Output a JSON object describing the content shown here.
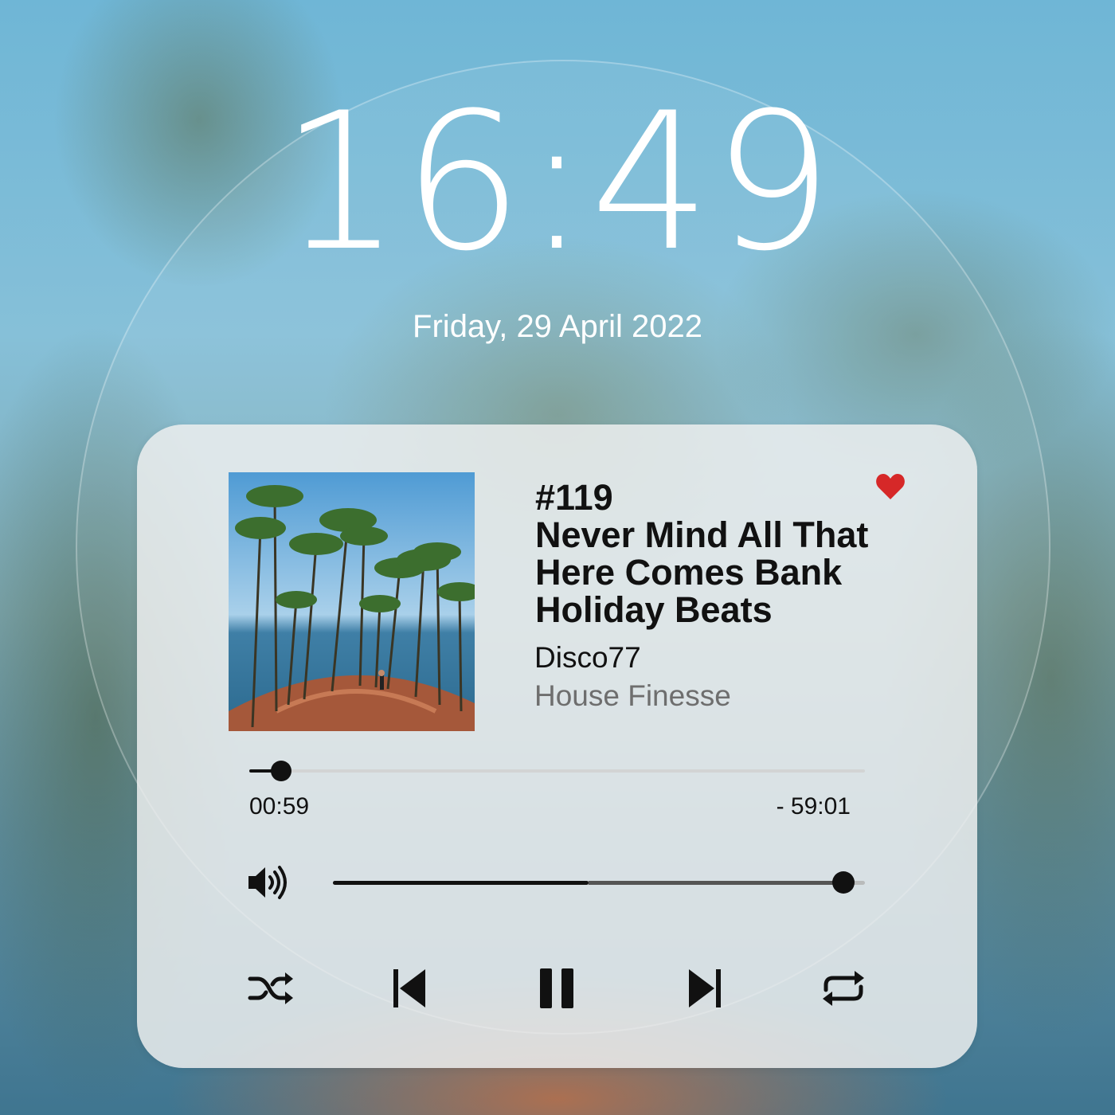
{
  "lock_screen": {
    "time": "16:49",
    "date": "Friday, 29 April 2022"
  },
  "player": {
    "album_art": "palm-trees-beach-photo",
    "liked": true,
    "heart_color": "#d62828",
    "episode": "#119",
    "title": "Never Mind All That Here Comes Bank Holiday Beats",
    "artist": "Disco77",
    "album": "House Finesse",
    "elapsed": "00:59",
    "remaining": "- 59:01",
    "progress_fraction": 0.0164,
    "volume_fraction": 0.96,
    "icons": {
      "volume": "volume-icon",
      "shuffle": "shuffle-icon",
      "previous": "skip-previous-icon",
      "play_pause": "pause-icon",
      "next": "skip-next-icon",
      "repeat": "repeat-icon"
    }
  }
}
